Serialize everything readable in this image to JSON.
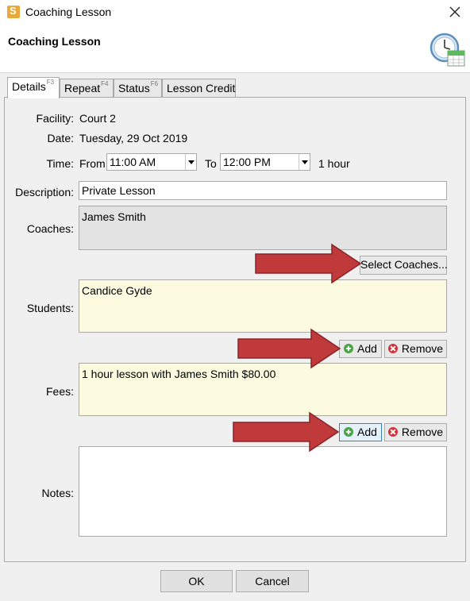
{
  "window": {
    "title": "Coaching Lesson",
    "close_icon": "close-icon",
    "app_icon": "app-logo-icon"
  },
  "header": {
    "title": "Coaching Lesson",
    "icon": "clock-calendar-icon"
  },
  "tabs": [
    {
      "label": "Details",
      "shortcut": "F3"
    },
    {
      "label": "Repeat",
      "shortcut": "F4"
    },
    {
      "label": "Status",
      "shortcut": "F6"
    },
    {
      "label": "Lesson Credit",
      "shortcut": ""
    }
  ],
  "details": {
    "facility_label": "Facility:",
    "facility_value": "Court 2",
    "date_label": "Date:",
    "date_value": "Tuesday, 29 Oct 2019",
    "time_label": "Time:",
    "from_label": "From",
    "from_value": "11:00 AM",
    "to_label": "To",
    "to_value": "12:00 PM",
    "duration": "1 hour",
    "description_label": "Description:",
    "description_value": "Private Lesson",
    "coaches_label": "Coaches:",
    "coaches_value": "James Smith",
    "select_coaches_label": "Select Coaches...",
    "students_label": "Students:",
    "students_value": "Candice Gyde",
    "add_label": "Add",
    "remove_label": "Remove",
    "fees_label": "Fees:",
    "fees_value": "1 hour lesson with James Smith $80.00",
    "notes_label": "Notes:",
    "notes_value": ""
  },
  "footer": {
    "ok_label": "OK",
    "cancel_label": "Cancel"
  },
  "colors": {
    "arrow": "#c0393b",
    "notes_bg": "#fdfbdf",
    "coaches_bg": "#e3e3e3"
  }
}
